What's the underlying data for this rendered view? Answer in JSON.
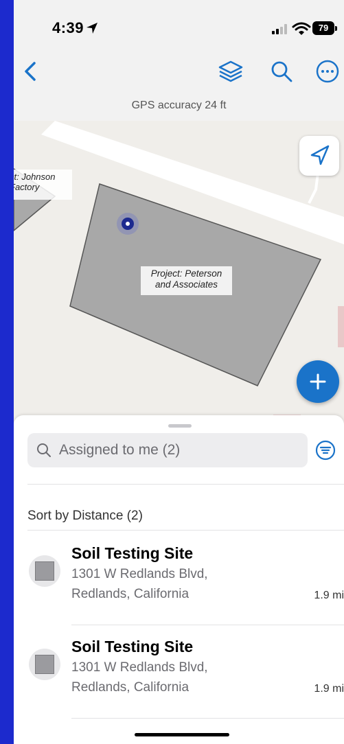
{
  "status_bar": {
    "time": "4:39",
    "battery": "79"
  },
  "nav": {
    "back_icon": "chevron-left-icon",
    "layers_icon": "layers-icon",
    "search_icon": "search-icon",
    "more_icon": "ellipsis-circle-icon"
  },
  "gps_accuracy": "GPS accuracy 24 ft",
  "map": {
    "labels": [
      {
        "line1": "ct: Johnson",
        "line2": "Factory"
      },
      {
        "line1": "Project: Peterson",
        "line2": "and Associates"
      }
    ],
    "accent": "#1a73c9"
  },
  "sheet": {
    "search_placeholder": "Assigned to me (2)",
    "sort_label": "Sort by Distance (2)",
    "items": [
      {
        "title": "Soil Testing Site",
        "address_line1": "1301 W Redlands Blvd,",
        "address_line2": "Redlands, California",
        "distance": "1.9 mi"
      },
      {
        "title": "Soil Testing Site",
        "address_line1": "1301 W Redlands Blvd,",
        "address_line2": "Redlands, California",
        "distance": "1.9 mi"
      }
    ]
  }
}
